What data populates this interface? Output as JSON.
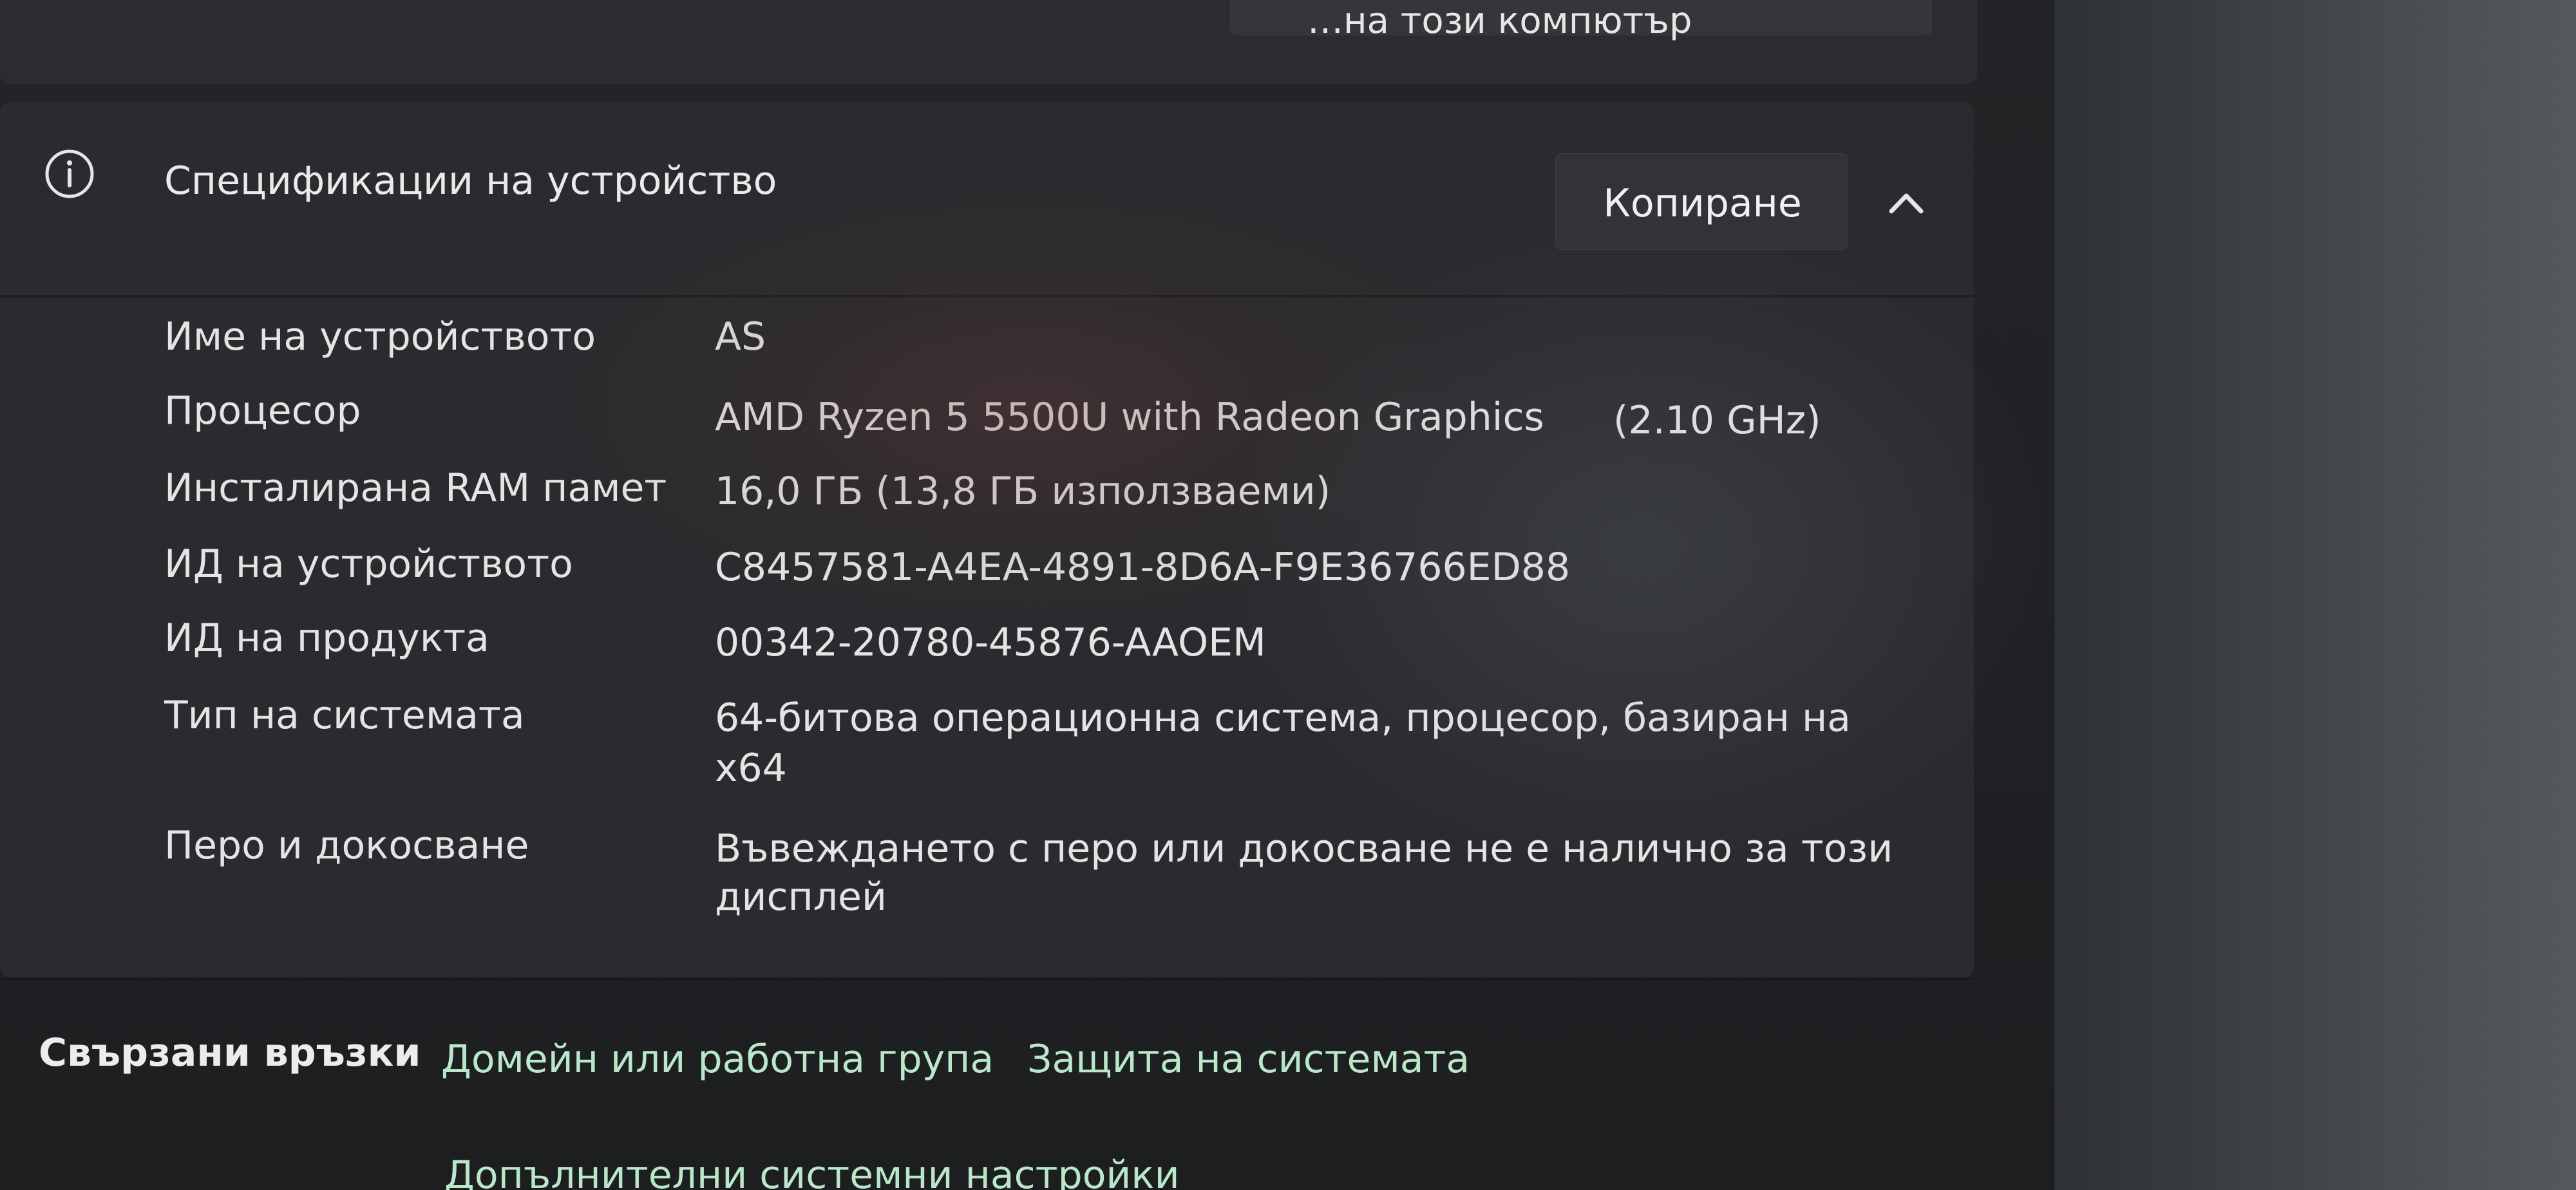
{
  "top_card": {
    "button_label": "…на този компютър"
  },
  "specs": {
    "title": "Спецификации на устройство",
    "copy_label": "Копиране",
    "rows": [
      {
        "label": "Име на устройството",
        "value": "AS"
      },
      {
        "label": "Процесор",
        "value": "AMD Ryzen 5 5500U with Radeon Graphics",
        "extra": "(2.10 GHz)"
      },
      {
        "label": "Инсталирана RAM памет",
        "value": "16,0 ГБ (13,8 ГБ използваеми)"
      },
      {
        "label": "ИД на устройството",
        "value": "C8457581-A4EA-4891-8D6A-F9E36766ED88"
      },
      {
        "label": "ИД на продукта",
        "value": "00342-20780-45876-AAOEM"
      },
      {
        "label": "Тип на системата",
        "value": "64-битова операционна система, процесор, базиран на",
        "value_line2": "x64"
      },
      {
        "label": "Перо и докосване",
        "value": "Въвеждането с перо или докосване не е налично за този",
        "value_line2": "дисплей"
      }
    ]
  },
  "related": {
    "label": "Свързани връзки",
    "links": [
      {
        "label": "Домейн или работна група"
      },
      {
        "label": "Защита на системата"
      },
      {
        "label": "Допълнителни системни настройки"
      }
    ]
  },
  "colors": {
    "card_bg": "#2a2b2e",
    "link": "#b9e8c9",
    "text": "#e4e4e4"
  },
  "icons": {
    "info": "info-circle-icon",
    "collapse": "chevron-up-icon"
  }
}
